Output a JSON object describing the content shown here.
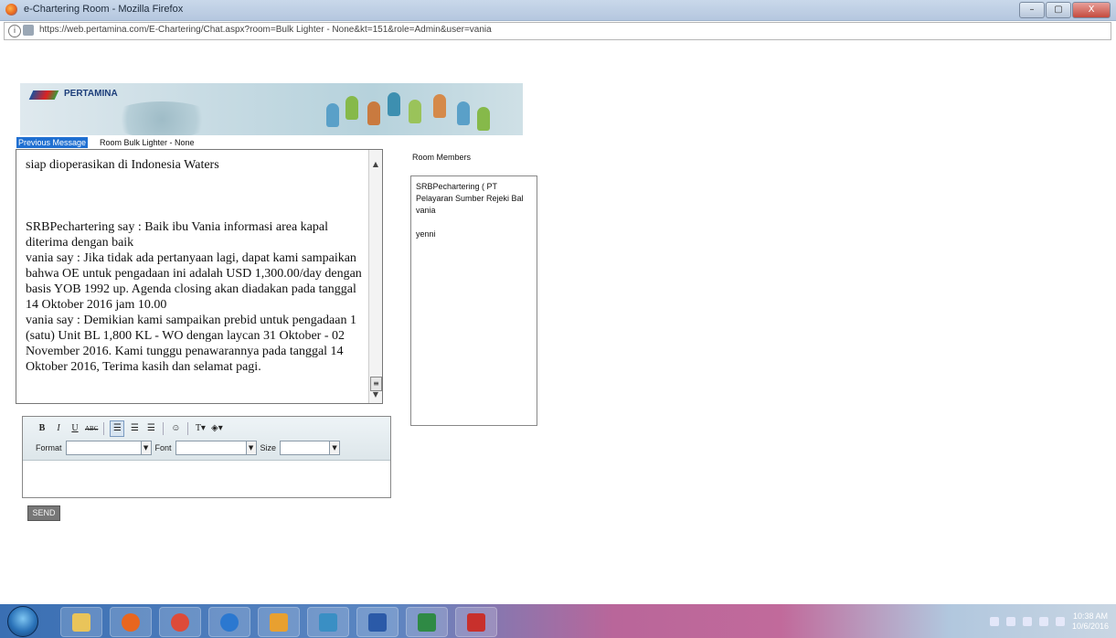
{
  "window": {
    "title": "e-Chartering Room - Mozilla Firefox",
    "url": "https://web.pertamina.com/E-Chartering/Chat.aspx?room=Bulk Lighter - None&kt=151&role=Admin&user=vania",
    "min_label": "–",
    "max_label": "▢",
    "close_label": "X"
  },
  "banner": {
    "logo_text": "PERTAMINA"
  },
  "chat": {
    "prev_label": "Previous Message",
    "room_label": "Room Bulk Lighter - None",
    "messages": [
      "siap dioperasikan di Indonesia Waters",
      "SRBPechartering say : Baik ibu Vania informasi area kapal diterima dengan baik",
      "vania say : Jika tidak ada pertanyaan lagi, dapat kami sampaikan bahwa OE untuk pengadaan ini adalah USD 1,300.00/day dengan basis YOB 1992 up. Agenda closing akan diadakan pada tanggal 14 Oktober 2016 jam 10.00",
      "vania say : Demikian kami sampaikan prebid untuk pengadaan 1 (satu) Unit BL 1,800 KL - WO dengan laycan 31 Oktober - 02 November 2016. Kami tunggu penawarannya pada tanggal 14 Oktober 2016, Terima kasih dan selamat pagi."
    ]
  },
  "members": {
    "label": "Room Members",
    "items": [
      "SRBPechartering ( PT Pelayaran Sumber Rejeki Bal",
      "vania",
      "yenni"
    ]
  },
  "editor": {
    "bold": "B",
    "italic": "I",
    "underline": "U",
    "strike": "ABC",
    "format_label": "Format",
    "font_label": "Font",
    "size_label": "Size",
    "format_value": "",
    "font_value": "",
    "size_value": ""
  },
  "send_label": "SEND",
  "taskbar": {
    "time": "10:38 AM",
    "date": "10/6/2016"
  }
}
